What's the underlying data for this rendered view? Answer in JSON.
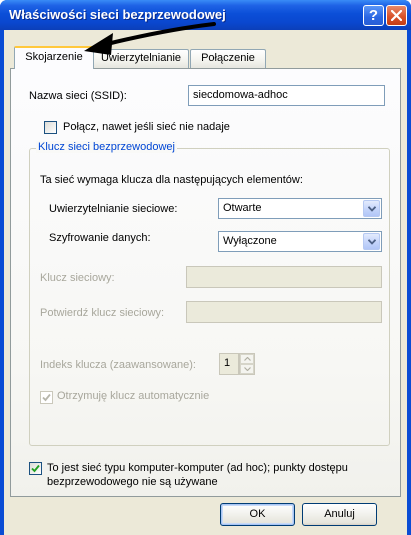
{
  "window": {
    "title": "Właściwości sieci bezprzewodowej",
    "help_glyph": "?",
    "help_icon": "question-mark-icon",
    "close_icon": "close-x-icon"
  },
  "tabs": [
    {
      "label": "Skojarzenie",
      "active": true
    },
    {
      "label": "Uwierzytelnianie",
      "active": false
    },
    {
      "label": "Połączenie",
      "active": false
    }
  ],
  "association": {
    "ssid_label": "Nazwa sieci (SSID):",
    "ssid_value": "siecdomowa-adhoc",
    "connect_even_if_not_broadcasting_label": "Połącz, nawet jeśli sieć nie nadaje",
    "connect_even_if_not_broadcasting_checked": false
  },
  "key_group": {
    "title": "Klucz sieci bezprzewodowej",
    "intro": "Ta sieć wymaga klucza dla następujących elementów:",
    "auth_label": "Uwierzytelnianie sieciowe:",
    "auth_value": "Otwarte",
    "encryption_label": "Szyfrowanie danych:",
    "encryption_value": "Wyłączone",
    "network_key_label": "Klucz sieciowy:",
    "network_key_value": "",
    "confirm_key_label": "Potwierdź klucz sieciowy:",
    "confirm_key_value": "",
    "key_index_label": "Indeks klucza (zaawansowane):",
    "key_index_value": "1",
    "auto_key_label": "Otrzymuję klucz automatycznie",
    "auto_key_checked": true,
    "auto_key_enabled": false
  },
  "adhoc": {
    "label_line1": "To jest sieć typu komputer-komputer (ad hoc); punkty dostępu",
    "label_line2": "bezprzewodowego nie są używane",
    "checked": true
  },
  "buttons": {
    "ok": "OK",
    "cancel": "Anuluj"
  },
  "colors": {
    "titlebar": "#0a47cf",
    "dialog_face": "#ece9d8",
    "group_title": "#0046d5",
    "disabled_text": "#a8a79c",
    "checkmark": "#21a121",
    "arrow": "#000000"
  }
}
